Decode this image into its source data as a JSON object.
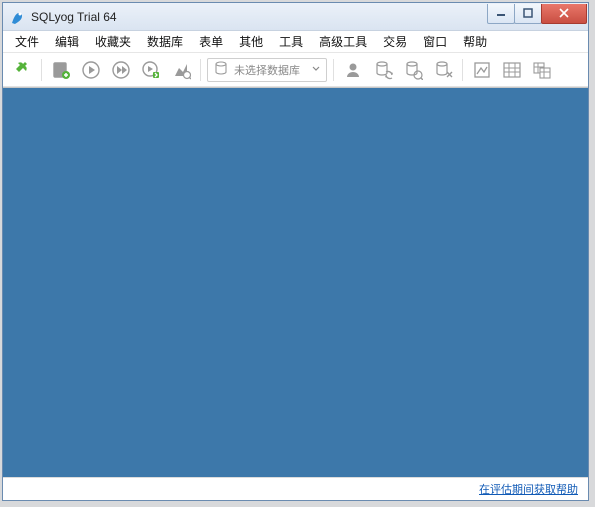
{
  "titlebar": {
    "title": "SQLyog Trial 64"
  },
  "menubar": {
    "items": [
      "文件",
      "编辑",
      "收藏夹",
      "数据库",
      "表单",
      "其他",
      "工具",
      "高级工具",
      "交易",
      "窗口",
      "帮助"
    ]
  },
  "toolbar": {
    "db_selector_placeholder": "未选择数据库"
  },
  "statusbar": {
    "link_text": "在评估期间获取帮助"
  }
}
